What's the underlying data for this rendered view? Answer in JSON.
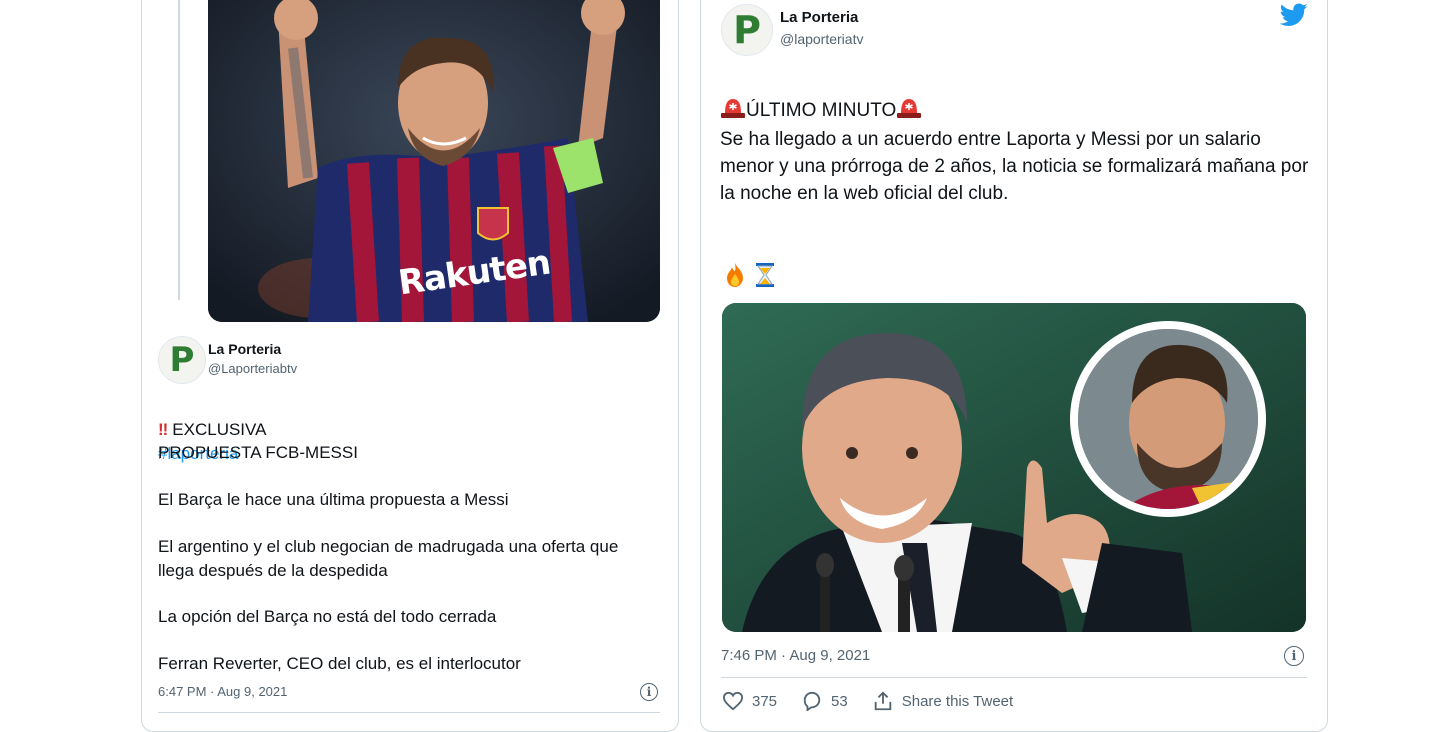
{
  "left_tweet": {
    "author_name": "La Porteria",
    "author_handle": "@Laporteriabtv",
    "avatar_letter": "P",
    "lines": {
      "exclusive_prefix": "EXCLUSIVA",
      "hashtag": "#laporteria",
      "p1": "PROPUESTA FCB-MESSI",
      "p2": "El Barça le hace una última propuesta a Messi",
      "p3": "El argentino y el club negocian de madrugada una oferta que llega después de la despedida",
      "p4": "La opción del Barça no está del todo cerrada",
      "p5": "Ferran Reverter, CEO del club, es el interlocutor"
    },
    "timestamp": "6:47 PM · Aug 9, 2021",
    "photo_jersey_text": "Rakuten"
  },
  "right_tweet": {
    "author_name": "La Porteria",
    "author_handle": "@laporteriatv",
    "avatar_letter": "P",
    "headline": "ÚLTIMO MINUTO",
    "body": "Se ha llegado a un acuerdo entre Laporta y Messi por un salario menor y una prórroga de 2 años, la noticia se formalizará mañana por la noche en la web oficial del club.",
    "timestamp": "7:46 PM · Aug 9, 2021",
    "likes": "375",
    "replies": "53",
    "share_label": "Share this Tweet"
  },
  "colors": {
    "accent": "#1d9bf0",
    "border": "#cfd9de",
    "muted": "#536471",
    "avatar_green": "#2e7d32"
  },
  "icons": [
    "twitter-bird-icon",
    "siren-icon",
    "fire-icon",
    "hourglass-icon",
    "heart-icon",
    "reply-icon",
    "share-icon",
    "info-icon",
    "double-exclamation-icon"
  ]
}
